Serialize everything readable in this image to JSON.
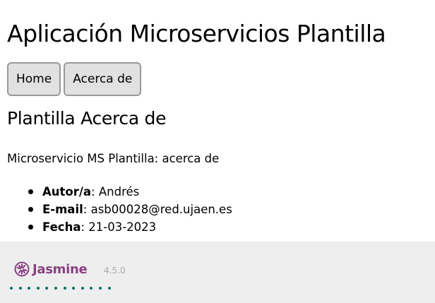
{
  "app": {
    "title": "Aplicación Microservicios Plantilla"
  },
  "nav": {
    "home_label": "Home",
    "about_label": "Acerca de"
  },
  "section": {
    "title": "Plantilla Acerca de",
    "description": "Microservicio MS Plantilla: acerca de"
  },
  "info": [
    {
      "label": "Autor/a",
      "value": "Andrés"
    },
    {
      "label": "E-mail",
      "value": "asb00028@red.ujaen.es"
    },
    {
      "label": "Fecha",
      "value": "21-03-2023"
    }
  ],
  "footer": {
    "brand": "Jasmine",
    "version": "4.5.0",
    "spec_dot_count": 12,
    "spec_status": "passed",
    "colors": {
      "brand": "#8a4182",
      "passed_dot": "#007069",
      "background": "#eeeeee"
    }
  }
}
